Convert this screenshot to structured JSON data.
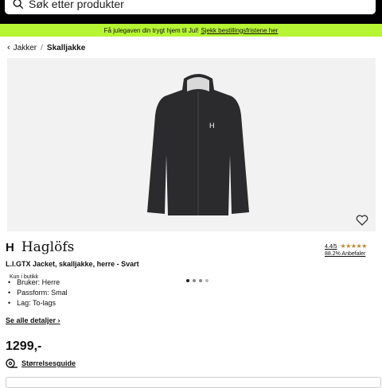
{
  "search": {
    "placeholder": "Søk etter produkter"
  },
  "promo": {
    "text": "Få julegaven din trygt hjem til Jul!",
    "link": "Sjekk bestillingsfristene her"
  },
  "breadcrumb": {
    "parent": "Jakker",
    "current": "Skalljakke"
  },
  "gallery": {
    "badge": "Kun i butikk",
    "image_count": 4,
    "active_index": 0
  },
  "product": {
    "brand": "Haglöfs",
    "brand_mark": "H",
    "rating": "4.4/5",
    "recommend": "88.2% Anbefaler",
    "title": "L.I.GTX Jacket, skalljakke, herre - Svart",
    "features": [
      "Bruker: Herre",
      "Passform: Smal",
      "Lag: To-lags"
    ],
    "details_link": "Se alle detaljer",
    "price": "1299,-",
    "size_guide": "Størrelsesguide"
  },
  "colors": {
    "promo_bg": "#b6f533",
    "header_bg": "#000000",
    "star": "#b58a2a"
  }
}
